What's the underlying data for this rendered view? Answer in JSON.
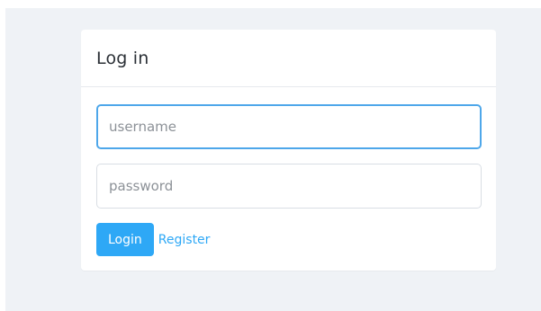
{
  "login_card": {
    "title": "Log in",
    "username": {
      "value": "",
      "placeholder": "username"
    },
    "password": {
      "value": "",
      "placeholder": "password"
    },
    "login_button_label": "Login",
    "register_link_label": "Register"
  },
  "colors": {
    "background": "#eff2f6",
    "accent": "#2ea8f6",
    "focus_border": "#4ea7ea"
  }
}
